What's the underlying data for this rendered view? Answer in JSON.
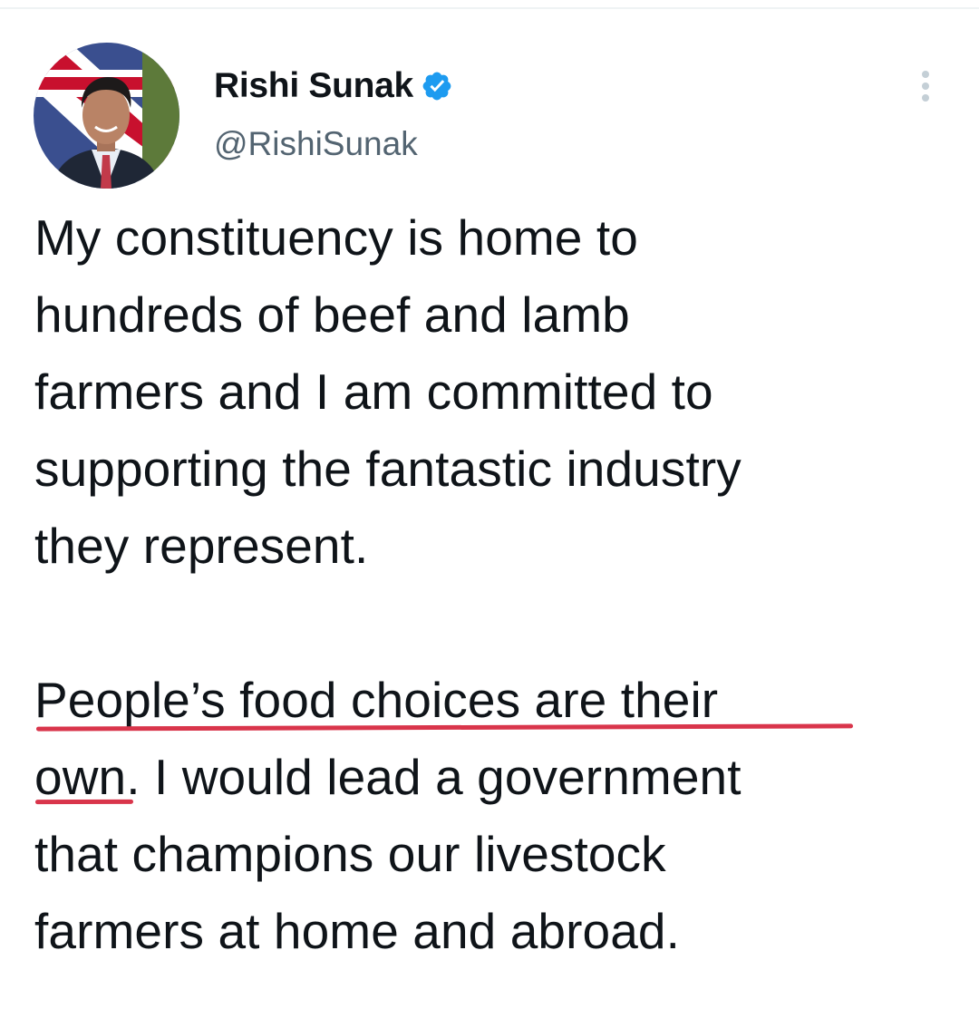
{
  "author": {
    "display_name": "Rishi Sunak",
    "handle": "@RishiSunak",
    "verified": true,
    "verified_icon": "verified-badge-icon",
    "verified_color": "#1d9bf0"
  },
  "menu": {
    "icon": "more-vertical-icon"
  },
  "tweet": {
    "paragraph_1": "My constituency is home to\nhundreds of beef and lamb\nfarmers and I am committed to\nsupporting the fantastic industry\nthey represent.",
    "paragraph_2": "People’s food choices are their\nown. I would lead a government\nthat champions our livestock\nfarmers at home and abroad."
  },
  "annotation": {
    "underline_color": "#d9354b"
  }
}
